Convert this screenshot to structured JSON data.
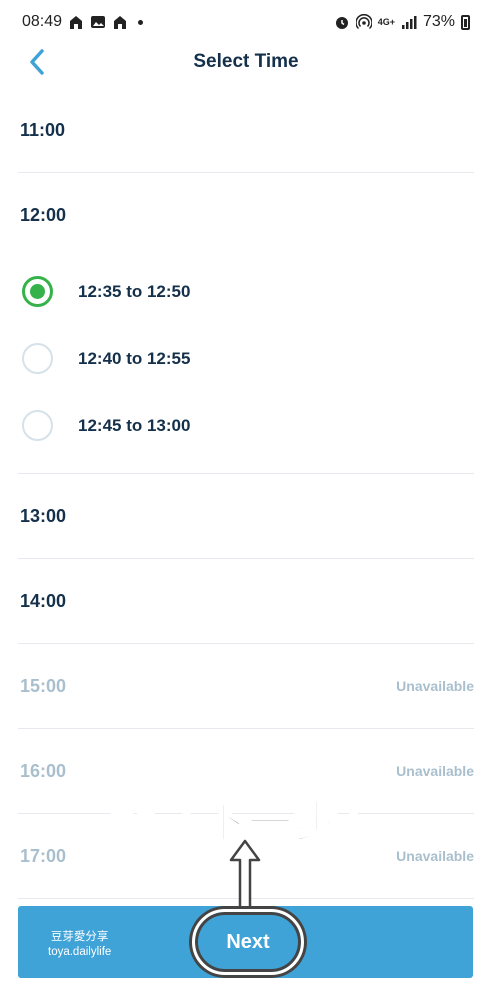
{
  "status_bar": {
    "time": "08:49",
    "network": "4G+",
    "battery": "73%"
  },
  "header": {
    "title": "Select Time",
    "back_icon": "chevron-left-icon"
  },
  "hours": {
    "h11": {
      "label": "11:00"
    },
    "h12": {
      "label": "12:00",
      "slots": [
        {
          "label": "12:35 to 12:50",
          "selected": true
        },
        {
          "label": "12:40 to 12:55",
          "selected": false
        },
        {
          "label": "12:45 to 13:00",
          "selected": false
        }
      ]
    },
    "h13": {
      "label": "13:00"
    },
    "h14": {
      "label": "14:00"
    },
    "h15": {
      "label": "15:00",
      "status": "Unavailable"
    },
    "h16": {
      "label": "16:00",
      "status": "Unavailable"
    },
    "h17": {
      "label": "17:00",
      "status": "Unavailable"
    }
  },
  "overlay": {
    "caption": "點「下一步」"
  },
  "bottom": {
    "watermark_line1": "豆芽愛分享",
    "watermark_line2": "toya.dailylife",
    "next_label": "Next"
  },
  "colors": {
    "accent": "#3fa3d8",
    "selected": "#36b24a",
    "text_dark": "#14304a",
    "text_disabled": "#a9bfcd"
  }
}
